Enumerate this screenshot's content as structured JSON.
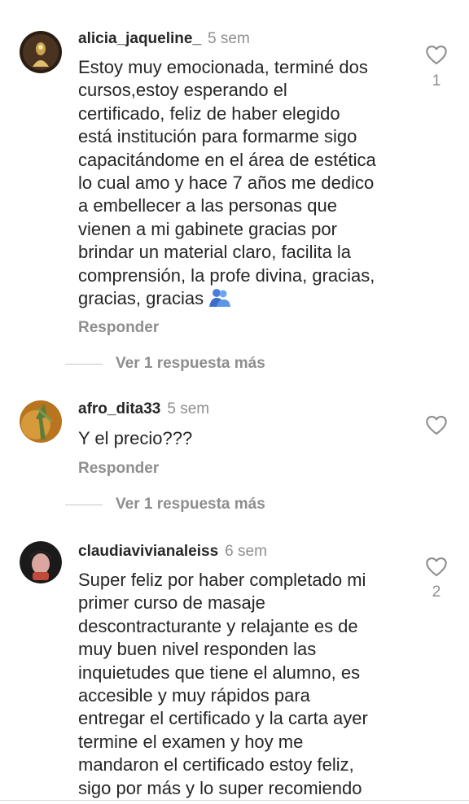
{
  "comments": [
    {
      "username": "alicia_jaqueline_",
      "time": "5 sem",
      "lines": [
        "Estoy muy emocionada, terminé dos",
        "cursos,estoy esperando el",
        "certificado, feliz de haber elegido",
        "está institución para formarme sigo",
        "capacitándome en el área de estética",
        "lo cual amo y hace 7 años me dedico",
        "a embellecer a las personas que",
        "vienen a mi gabinete gracias por",
        "brindar un material claro, facilita la",
        "comprensión, la profe divina, gracias,",
        "gracias, gracias"
      ],
      "emoji": "people-hugging-emoji",
      "reply_label": "Responder",
      "more_replies_label": "Ver 1 respuesta más",
      "like_count": "1",
      "avatar_colors": [
        "#3a2a1a",
        "#c9a24a"
      ]
    },
    {
      "username": "afro_dita33",
      "time": "5 sem",
      "lines": [
        "Y el precio???"
      ],
      "reply_label": "Responder",
      "more_replies_label": "Ver 1 respuesta más",
      "like_count": "",
      "avatar_colors": [
        "#c27a1c",
        "#6a8a3a"
      ]
    },
    {
      "username": "claudiavivianaleiss",
      "time": "6 sem",
      "lines": [
        "Super feliz  por haber completado mi",
        "primer curso de masaje",
        "descontracturante y relajante es de",
        "muy buen nivel responden las",
        "inquietudes que tiene el alumno, es",
        "accesible y muy rápidos para",
        "entregar el certificado y la carta ayer",
        "termine el examen y hoy me",
        "mandaron el certificado estoy feliz,",
        "sigo por más y lo super recomiendo"
      ],
      "like_count": "2",
      "avatar_colors": [
        "#111111",
        "#d9a6a0"
      ]
    }
  ],
  "colors": {
    "text": "#262626",
    "secondary": "#8e8e8e",
    "divider": "#c7c7c7",
    "emoji": "#3b82f6"
  }
}
